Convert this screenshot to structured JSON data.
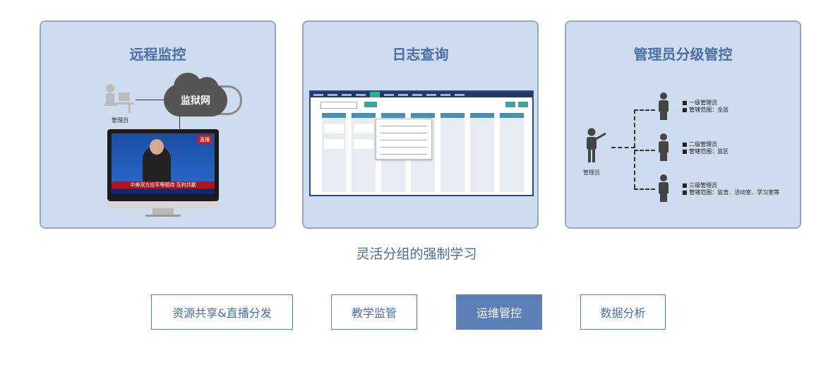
{
  "cards": [
    {
      "title": "远程监控",
      "admin_label": "管理员",
      "cloud_label": "监狱网",
      "tv_banner": "中美双方应平等相待 互利共赢",
      "tv_badge": "直播"
    },
    {
      "title": "日志查询"
    },
    {
      "title": "管理员分级管控",
      "admin_label": "管理员",
      "levels": [
        {
          "name": "一级管理员",
          "scope": "管辖范围：全监"
        },
        {
          "name": "二级管理员",
          "scope": "管辖范围：监区"
        },
        {
          "name": "三级管理员",
          "scope": "管辖范围：监舍、活动室、学习室等"
        }
      ]
    }
  ],
  "caption": "灵活分组的强制学习",
  "tabs": [
    {
      "label": "资源共享&直播分发",
      "active": false
    },
    {
      "label": "教学监管",
      "active": false
    },
    {
      "label": "运维管控",
      "active": true
    },
    {
      "label": "数据分析",
      "active": false
    }
  ],
  "colors": {
    "card_bg": "#cddcef",
    "accent": "#4a6fa5",
    "active_tab": "#5b80b8"
  }
}
